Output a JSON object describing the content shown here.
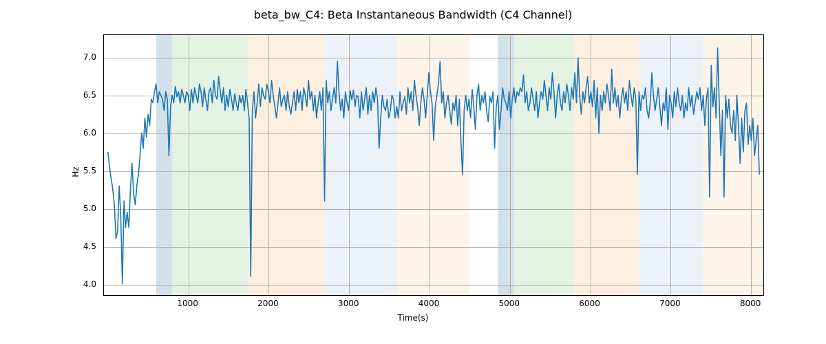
{
  "chart_data": {
    "type": "line",
    "title": "beta_bw_C4: Beta Instantaneous Bandwidth (C4 Channel)",
    "xlabel": "Time(s)",
    "ylabel": "Hz",
    "xlim": [
      -50,
      8170
    ],
    "ylim": [
      3.85,
      7.3
    ],
    "xticks": [
      1000,
      2000,
      3000,
      4000,
      5000,
      6000,
      7000,
      8000
    ],
    "yticks": [
      4.0,
      4.5,
      5.0,
      5.5,
      6.0,
      6.5,
      7.0
    ],
    "spans": [
      {
        "x0": 600,
        "x1": 800,
        "color": "#8fb4c8"
      },
      {
        "x0": 800,
        "x1": 1750,
        "color": "#b8dfb8"
      },
      {
        "x0": 1750,
        "x1": 2700,
        "color": "#f9d6b1"
      },
      {
        "x0": 2700,
        "x1": 3600,
        "color": "#cfddeb"
      },
      {
        "x0": 3600,
        "x1": 4500,
        "color": "#f9e2c8"
      },
      {
        "x0": 4850,
        "x1": 5050,
        "color": "#8fb4c8"
      },
      {
        "x0": 5050,
        "x1": 5800,
        "color": "#b8dfb8"
      },
      {
        "x0": 5800,
        "x1": 6600,
        "color": "#f9d6b1"
      },
      {
        "x0": 6600,
        "x1": 7400,
        "color": "#cfddeb"
      },
      {
        "x0": 7400,
        "x1": 8170,
        "color": "#f9e2c8"
      }
    ],
    "x": [
      0,
      20,
      40,
      60,
      80,
      100,
      120,
      140,
      160,
      180,
      200,
      220,
      240,
      260,
      280,
      300,
      320,
      340,
      360,
      380,
      400,
      420,
      440,
      460,
      480,
      500,
      520,
      540,
      560,
      580,
      600,
      620,
      640,
      660,
      680,
      700,
      720,
      740,
      760,
      780,
      800,
      820,
      840,
      860,
      880,
      900,
      920,
      940,
      960,
      980,
      1000,
      1020,
      1040,
      1060,
      1080,
      1100,
      1120,
      1140,
      1160,
      1180,
      1200,
      1220,
      1240,
      1260,
      1280,
      1300,
      1320,
      1340,
      1360,
      1380,
      1400,
      1420,
      1440,
      1460,
      1480,
      1500,
      1520,
      1540,
      1560,
      1580,
      1600,
      1620,
      1640,
      1660,
      1680,
      1700,
      1720,
      1740,
      1760,
      1780,
      1800,
      1820,
      1840,
      1860,
      1880,
      1900,
      1920,
      1940,
      1960,
      1980,
      2000,
      2020,
      2040,
      2060,
      2080,
      2100,
      2120,
      2140,
      2160,
      2180,
      2200,
      2220,
      2240,
      2260,
      2280,
      2300,
      2320,
      2340,
      2360,
      2380,
      2400,
      2420,
      2440,
      2460,
      2480,
      2500,
      2520,
      2540,
      2560,
      2580,
      2600,
      2620,
      2640,
      2660,
      2680,
      2700,
      2720,
      2740,
      2760,
      2780,
      2800,
      2820,
      2840,
      2860,
      2880,
      2900,
      2920,
      2940,
      2960,
      2980,
      3000,
      3020,
      3040,
      3060,
      3080,
      3100,
      3120,
      3140,
      3160,
      3180,
      3200,
      3220,
      3240,
      3260,
      3280,
      3300,
      3320,
      3340,
      3360,
      3380,
      3400,
      3420,
      3440,
      3460,
      3480,
      3500,
      3520,
      3540,
      3560,
      3580,
      3600,
      3620,
      3640,
      3660,
      3680,
      3700,
      3720,
      3740,
      3760,
      3780,
      3800,
      3820,
      3840,
      3860,
      3880,
      3900,
      3920,
      3940,
      3960,
      3980,
      4000,
      4020,
      4040,
      4060,
      4080,
      4100,
      4120,
      4140,
      4160,
      4180,
      4200,
      4220,
      4240,
      4260,
      4280,
      4300,
      4320,
      4340,
      4360,
      4380,
      4400,
      4420,
      4440,
      4460,
      4480,
      4500,
      4520,
      4540,
      4560,
      4580,
      4600,
      4620,
      4640,
      4660,
      4680,
      4700,
      4720,
      4740,
      4760,
      4780,
      4800,
      4820,
      4840,
      4860,
      4880,
      4900,
      4920,
      4940,
      4960,
      4980,
      5000,
      5020,
      5040,
      5060,
      5080,
      5100,
      5120,
      5140,
      5160,
      5180,
      5200,
      5220,
      5240,
      5260,
      5280,
      5300,
      5320,
      5340,
      5360,
      5380,
      5400,
      5420,
      5440,
      5460,
      5480,
      5500,
      5520,
      5540,
      5560,
      5580,
      5600,
      5620,
      5640,
      5660,
      5680,
      5700,
      5720,
      5740,
      5760,
      5780,
      5800,
      5820,
      5840,
      5860,
      5880,
      5900,
      5920,
      5940,
      5960,
      5980,
      6000,
      6020,
      6040,
      6060,
      6080,
      6100,
      6120,
      6140,
      6160,
      6180,
      6200,
      6220,
      6240,
      6260,
      6280,
      6300,
      6320,
      6340,
      6360,
      6380,
      6400,
      6420,
      6440,
      6460,
      6480,
      6500,
      6520,
      6540,
      6560,
      6580,
      6600,
      6620,
      6640,
      6660,
      6680,
      6700,
      6720,
      6740,
      6760,
      6780,
      6800,
      6820,
      6840,
      6860,
      6880,
      6900,
      6920,
      6940,
      6960,
      6980,
      7000,
      7020,
      7040,
      7060,
      7080,
      7100,
      7120,
      7140,
      7160,
      7180,
      7200,
      7220,
      7240,
      7260,
      7280,
      7300,
      7320,
      7340,
      7360,
      7380,
      7400,
      7420,
      7440,
      7460,
      7480,
      7500,
      7520,
      7540,
      7560,
      7580,
      7600,
      7620,
      7640,
      7660,
      7680,
      7700,
      7720,
      7740,
      7760,
      7780,
      7800,
      7820,
      7840,
      7860,
      7880,
      7900,
      7920,
      7940,
      7960,
      7980,
      8000,
      8020,
      8040,
      8060,
      8080,
      8100,
      8120
    ],
    "values": [
      5.75,
      5.55,
      5.4,
      5.25,
      5.05,
      4.6,
      4.7,
      5.3,
      4.9,
      4.0,
      5.1,
      4.75,
      4.95,
      4.75,
      5.25,
      5.6,
      5.2,
      5.05,
      5.3,
      5.45,
      5.7,
      6.0,
      5.8,
      6.2,
      5.95,
      6.25,
      6.1,
      6.45,
      6.4,
      6.55,
      6.65,
      6.4,
      6.55,
      6.5,
      6.45,
      6.3,
      6.55,
      6.45,
      5.7,
      6.35,
      6.5,
      6.4,
      6.62,
      6.48,
      6.55,
      6.4,
      6.58,
      6.5,
      6.4,
      6.55,
      6.5,
      6.3,
      6.58,
      6.4,
      6.6,
      6.5,
      6.4,
      6.65,
      6.55,
      6.35,
      6.6,
      6.45,
      6.3,
      6.55,
      6.6,
      6.4,
      6.7,
      6.5,
      6.45,
      6.75,
      6.55,
      6.4,
      6.6,
      6.3,
      6.5,
      6.35,
      6.58,
      6.45,
      6.3,
      6.52,
      6.4,
      6.3,
      6.5,
      6.4,
      6.5,
      6.3,
      6.58,
      6.4,
      6.2,
      4.1,
      6.3,
      6.55,
      6.2,
      6.4,
      6.65,
      6.35,
      6.6,
      6.5,
      6.45,
      6.65,
      6.55,
      6.4,
      6.7,
      6.5,
      6.35,
      6.2,
      6.4,
      6.6,
      6.35,
      6.45,
      6.5,
      6.3,
      6.55,
      6.35,
      6.25,
      6.4,
      6.55,
      6.3,
      6.58,
      6.4,
      6.55,
      6.3,
      6.6,
      6.5,
      6.35,
      6.7,
      6.45,
      6.55,
      6.3,
      6.5,
      6.2,
      6.4,
      6.55,
      6.3,
      6.6,
      5.1,
      6.7,
      6.4,
      6.55,
      6.3,
      6.45,
      6.6,
      6.4,
      6.95,
      6.55,
      6.3,
      6.45,
      6.2,
      6.55,
      6.4,
      6.3,
      6.56,
      6.44,
      6.57,
      6.35,
      6.5,
      6.48,
      6.2,
      6.55,
      6.3,
      6.45,
      6.6,
      6.25,
      6.5,
      6.3,
      6.55,
      6.4,
      6.6,
      6.45,
      5.8,
      6.2,
      6.5,
      6.35,
      6.3,
      6.45,
      6.2,
      6.3,
      6.5,
      6.45,
      6.2,
      6.35,
      6.2,
      6.55,
      6.3,
      6.4,
      6.48,
      6.25,
      6.6,
      6.4,
      6.55,
      6.3,
      6.7,
      6.5,
      6.35,
      6.1,
      6.4,
      6.6,
      6.45,
      6.2,
      6.5,
      6.8,
      6.55,
      6.4,
      5.9,
      6.35,
      6.5,
      6.65,
      6.95,
      6.4,
      6.55,
      6.2,
      6.4,
      6.5,
      6.3,
      6.12,
      6.4,
      6.3,
      6.5,
      6.1,
      6.45,
      5.9,
      5.45,
      6.3,
      6.5,
      6.3,
      6.45,
      6.2,
      6.58,
      6.35,
      6.05,
      6.5,
      6.65,
      6.3,
      6.5,
      6.4,
      6.55,
      6.3,
      6.15,
      6.48,
      6.4,
      6.55,
      5.8,
      6.35,
      6.5,
      6.05,
      6.3,
      6.6,
      6.45,
      6.4,
      6.3,
      6.55,
      6.2,
      6.45,
      6.6,
      6.4,
      6.55,
      6.5,
      6.6,
      6.55,
      6.77,
      6.4,
      6.55,
      6.3,
      6.4,
      6.6,
      6.45,
      6.3,
      6.55,
      6.2,
      6.4,
      6.55,
      6.45,
      6.7,
      6.5,
      6.3,
      6.6,
      6.45,
      6.8,
      6.55,
      6.2,
      6.5,
      6.65,
      6.4,
      6.3,
      6.55,
      6.4,
      6.65,
      6.5,
      6.3,
      6.6,
      6.45,
      6.8,
      6.4,
      7.0,
      6.5,
      6.25,
      6.55,
      6.4,
      6.6,
      6.75,
      6.4,
      6.55,
      6.35,
      6.7,
      6.2,
      6.6,
      6.0,
      6.5,
      6.3,
      6.55,
      6.4,
      6.65,
      6.5,
      6.3,
      6.85,
      6.4,
      6.6,
      6.35,
      6.5,
      6.2,
      6.45,
      6.6,
      6.4,
      6.55,
      6.3,
      6.7,
      6.5,
      6.35,
      6.6,
      6.45,
      5.45,
      6.55,
      6.3,
      6.5,
      6.45,
      6.6,
      6.3,
      6.2,
      6.4,
      6.8,
      6.5,
      6.3,
      6.45,
      6.6,
      6.35,
      6.1,
      6.4,
      6.3,
      6.6,
      6.05,
      6.5,
      6.4,
      6.2,
      6.55,
      6.35,
      6.6,
      6.4,
      6.3,
      6.5,
      6.2,
      6.4,
      6.3,
      6.6,
      6.35,
      6.5,
      6.25,
      6.4,
      6.55,
      6.45,
      6.6,
      6.3,
      6.5,
      6.1,
      6.45,
      6.6,
      5.15,
      6.9,
      6.35,
      6.6,
      6.2,
      7.13,
      6.4,
      5.7,
      6.3,
      5.15,
      6.5,
      6.2,
      6.45,
      6.1,
      6.0,
      6.3,
      5.9,
      6.5,
      6.1,
      5.6,
      6.2,
      5.75,
      6.3,
      6.4,
      5.85,
      6.1,
      5.9,
      6.2,
      5.7,
      5.9,
      6.1,
      5.45
    ]
  }
}
